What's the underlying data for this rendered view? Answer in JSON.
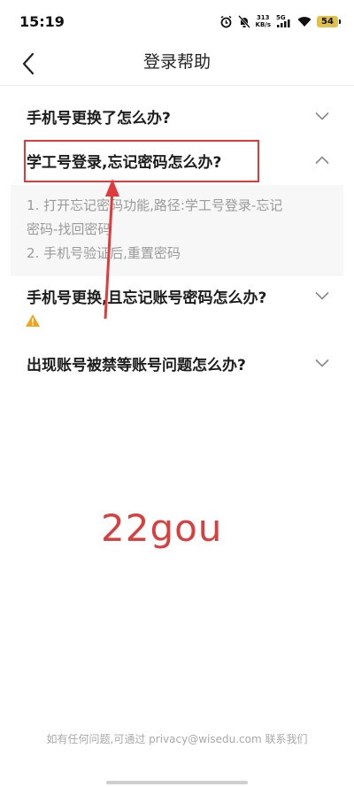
{
  "status_bar": {
    "time": "15:19",
    "net_speed_value": "313",
    "net_speed_unit": "KB/s",
    "network": "5G",
    "battery": "54"
  },
  "header": {
    "title": "登录帮助"
  },
  "faq": [
    {
      "question": "手机号更换了怎么办?",
      "expanded": false
    },
    {
      "question": "学工号登录,忘记密码怎么办?",
      "expanded": true,
      "answer_lines": [
        "1. 打开忘记密码功能,路径:学工号登录-忘记",
        "密码-找回密码",
        "2. 手机号验证后,重置密码"
      ]
    },
    {
      "question": "手机号更换,且忘记账号密码怎么办?",
      "expanded": false
    },
    {
      "question": "出现账号被禁等账号问题怎么办?",
      "expanded": false
    }
  ],
  "annotation": {
    "text": "22gou",
    "color": "#d8403f"
  },
  "footer": {
    "text": "如有任何问题,可通过 privacy@wisedu.com 联系我们"
  }
}
